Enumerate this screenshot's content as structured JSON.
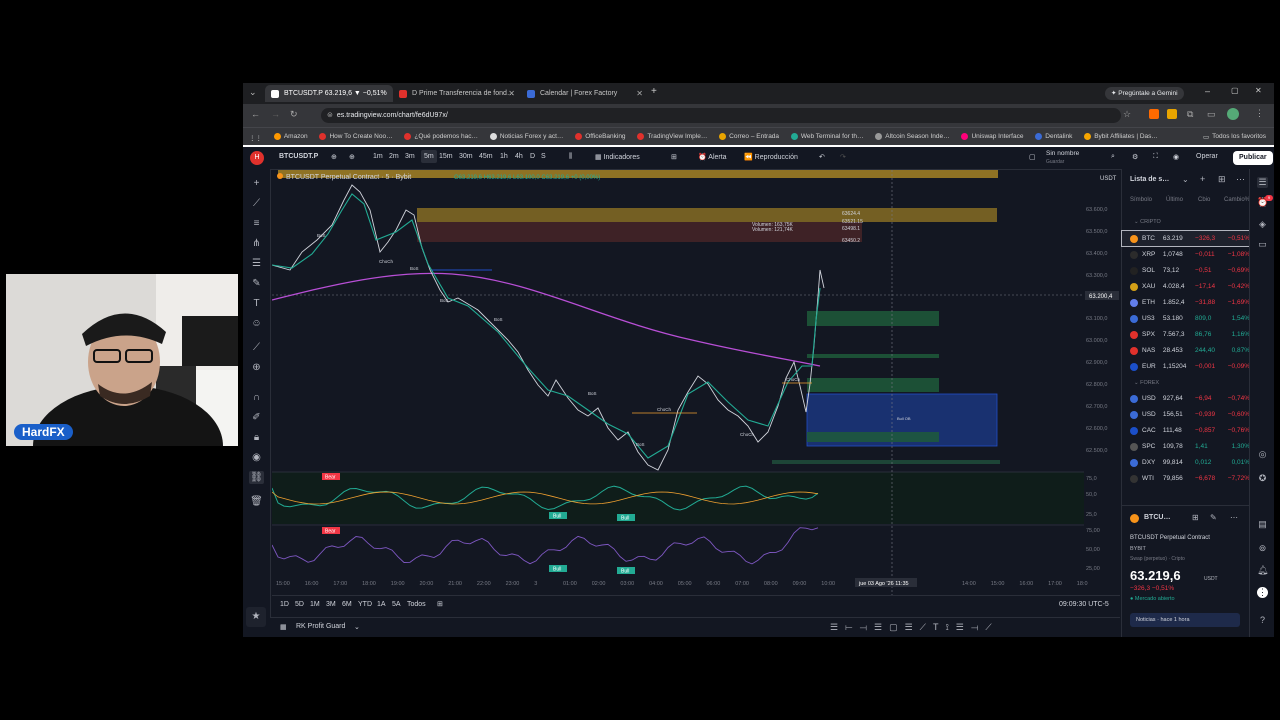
{
  "browser": {
    "tabs": [
      {
        "label": "BTCUSDT.P 63.219,6 ▼ −0,51%",
        "color": "#ffffff",
        "active": true
      },
      {
        "label": "D Prime Transferencia de fond…",
        "color": "#e0312c"
      },
      {
        "label": "Calendar | Forex Factory",
        "color": "#3b6bd6"
      }
    ],
    "gemini": "Pregúntale a Gemini",
    "url": "es.tradingview.com/chart/fe6dU97x/",
    "bookmarks": [
      "Amazon",
      "How To Create Noo…",
      "¿Qué podemos hac…",
      "Noticias Forex y act…",
      "OfficeBanking",
      "TradingView Imple…",
      "Correo – Entrada",
      "Web Terminal for th…",
      "Altcoin Season Inde…",
      "Uniswap Interface",
      "Dentalink",
      "Bybit Affiliates | Das…"
    ],
    "all_bookmarks": "Todos los favoritos"
  },
  "toolbar": {
    "symbol": "BTCUSDT.P",
    "intervals": [
      "1m",
      "2m",
      "3m",
      "5m",
      "15m",
      "30m",
      "45m",
      "1h",
      "4h",
      "D",
      "S"
    ],
    "active_interval": "5m",
    "indicators": "Indicadores",
    "alert": "Alerta",
    "replay": "Reproducción",
    "unnamed": "Sin nombre",
    "saved": "Guardar",
    "operate": "Operar",
    "publish": "Publicar"
  },
  "chart": {
    "legend_title": "BTCUSDT Perpetual Contract · 5 · Bybit",
    "legend_ohlc": "O63.219,6  H63.219,6  L63.100,0  C63.219,6  +0 (0,00%)",
    "quote_label": "USDT",
    "price_tag": "63.200,4",
    "levels": [
      "63624.4",
      "63521.15",
      "63498.1",
      "63450.2"
    ],
    "volume_labels": [
      "Volumen: 163,75K",
      "Volumen: 121,74K"
    ],
    "bos_label": "BoS",
    "choch_label": "ChoCh",
    "bear_label": "Bear",
    "bull_label": "Bull",
    "fvg_label": "Bull OB",
    "osc_axis": [
      "75,0",
      "50,0",
      "25,0"
    ],
    "osc2_axis": [
      "75,00",
      "50,00",
      "25,00"
    ],
    "price_axis": [
      "63.600,0",
      "63.500,0",
      "63.400,0",
      "63.300,0",
      "63.100,0",
      "63.000,0",
      "62.900,0",
      "62.800,0",
      "62.700,0",
      "62.600,0",
      "62.500,0"
    ],
    "time_axis": [
      "15:00",
      "16:00",
      "17:00",
      "18:00",
      "19:00",
      "20:00",
      "21:00",
      "22:00",
      "23:00",
      "3",
      "01:00",
      "02:00",
      "03:00",
      "04:00",
      "05:00",
      "06:00",
      "07:00",
      "08:00",
      "09:00",
      "10:00",
      "14:00",
      "15:00",
      "16:00",
      "17:00",
      "18:0"
    ],
    "crosshair_time": "jue 03 Ago '26   11:35"
  },
  "ranges": [
    "1D",
    "5D",
    "1M",
    "3M",
    "6M",
    "YTD",
    "1A",
    "5A",
    "Todos"
  ],
  "clock": "09:09:30 UTC-5",
  "bottom": {
    "panel": "RK Profit Guard"
  },
  "watchlist": {
    "title": "Lista de s…",
    "columns": [
      "Símbolo",
      "Último",
      "Cbio",
      "Cambio%"
    ],
    "section_crypto": "CRIPTO",
    "section_forex": "FOREX",
    "rows": [
      {
        "sym": "BTC",
        "last": "63.219",
        "chg": "−326,3",
        "pct": "−0,51%",
        "dir": "neg",
        "color": "#f7931a"
      },
      {
        "sym": "XRP",
        "last": "1,0748",
        "chg": "−0,011",
        "pct": "−1,08%",
        "dir": "neg",
        "color": "#2b2b2b"
      },
      {
        "sym": "SOL",
        "last": "73,12",
        "chg": "−0,51",
        "pct": "−0,69%",
        "dir": "neg",
        "color": "#222"
      },
      {
        "sym": "XAU",
        "last": "4.028,4",
        "chg": "−17,14",
        "pct": "−0,42%",
        "dir": "neg",
        "color": "#d4a017"
      },
      {
        "sym": "ETH",
        "last": "1.852,4",
        "chg": "−31,88",
        "pct": "−1,69%",
        "dir": "neg",
        "color": "#627eea"
      },
      {
        "sym": "US3",
        "last": "53.180",
        "chg": "809,0",
        "pct": "1,54%",
        "dir": "pos",
        "color": "#3b6bd6"
      },
      {
        "sym": "SPX",
        "last": "7.567,3",
        "chg": "86,76",
        "pct": "1,16%",
        "dir": "pos",
        "color": "#e0312c"
      },
      {
        "sym": "NAS",
        "last": "28.453",
        "chg": "244,40",
        "pct": "0,87%",
        "dir": "pos",
        "color": "#e0312c"
      },
      {
        "sym": "EUR",
        "last": "1,15204",
        "chg": "−0,001",
        "pct": "−0,09%",
        "dir": "neg",
        "color": "#1b4fc9"
      }
    ],
    "forex_rows": [
      {
        "sym": "USD",
        "last": "927,64",
        "chg": "−6,94",
        "pct": "−0,74%",
        "dir": "neg",
        "color": "#3b6bd6"
      },
      {
        "sym": "USD",
        "last": "156,51",
        "chg": "−0,939",
        "pct": "−0,60%",
        "dir": "neg",
        "color": "#3b6bd6"
      },
      {
        "sym": "CAC",
        "last": "111,48",
        "chg": "−0,857",
        "pct": "−0,76%",
        "dir": "neg",
        "color": "#1b4fc9"
      },
      {
        "sym": "SPC",
        "last": "109,78",
        "chg": "1,41",
        "pct": "1,30%",
        "dir": "pos",
        "color": "#555"
      },
      {
        "sym": "DXY",
        "last": "99,814",
        "chg": "0,012",
        "pct": "0,01%",
        "dir": "pos",
        "color": "#3b6bd6"
      },
      {
        "sym": "WTI",
        "last": "79,856",
        "chg": "−6,678",
        "pct": "−7,72%",
        "dir": "neg",
        "color": "#333"
      }
    ],
    "detail": {
      "sym": "BTCU…",
      "name": "BTCUSDT Perpetual Contract",
      "exchange": "BYBIT",
      "type": "Swap (perpetuo) · Cripto",
      "price": "63.219,6",
      "currency": "USDT",
      "change": "−326,3  −0,51%",
      "market": "Mercado abierto",
      "news": "Noticias · hace 1 hora"
    }
  },
  "webcam": {
    "label": "HardFX"
  }
}
